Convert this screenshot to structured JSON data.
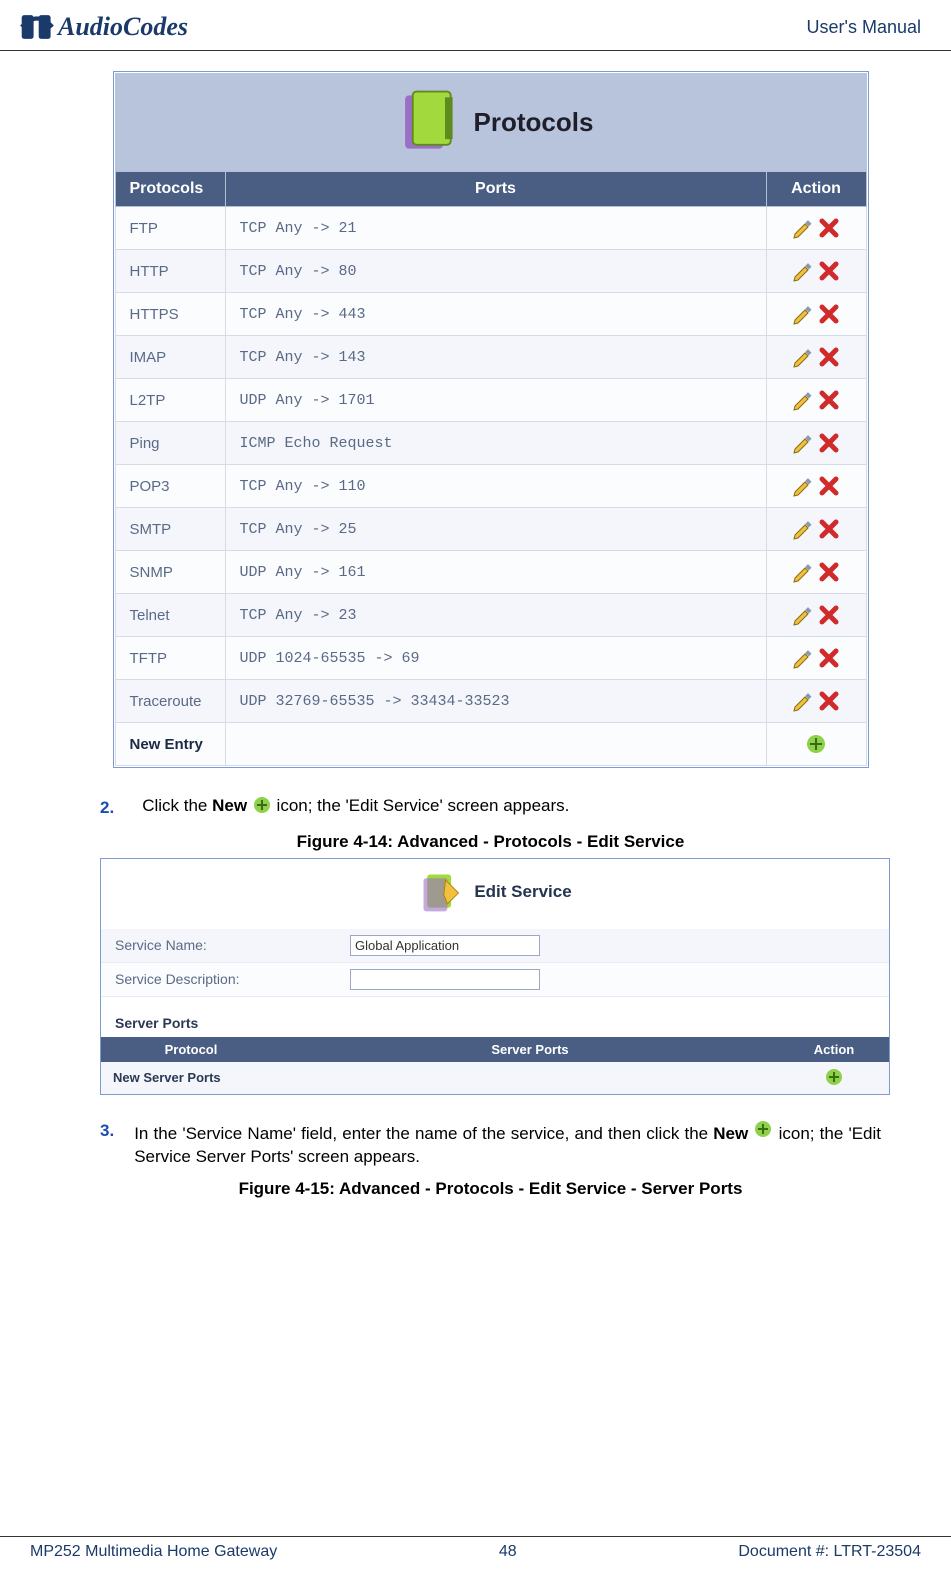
{
  "header": {
    "brand_text": "AudioCodes",
    "right_text": "User's Manual"
  },
  "figure1": {
    "title": "Protocols",
    "columns": [
      "Protocols",
      "Ports",
      "Action"
    ],
    "rows": [
      {
        "name": "FTP",
        "ports": "TCP  Any -> 21"
      },
      {
        "name": "HTTP",
        "ports": "TCP  Any -> 80"
      },
      {
        "name": "HTTPS",
        "ports": "TCP  Any -> 443"
      },
      {
        "name": "IMAP",
        "ports": "TCP  Any -> 143"
      },
      {
        "name": "L2TP",
        "ports": "UDP  Any -> 1701"
      },
      {
        "name": "Ping",
        "ports": "ICMP  Echo Request"
      },
      {
        "name": "POP3",
        "ports": "TCP  Any -> 110"
      },
      {
        "name": "SMTP",
        "ports": "TCP  Any -> 25"
      },
      {
        "name": "SNMP",
        "ports": "UDP  Any -> 161"
      },
      {
        "name": "Telnet",
        "ports": "TCP  Any -> 23"
      },
      {
        "name": "TFTP",
        "ports": "UDP  1024-65535 -> 69"
      },
      {
        "name": "Traceroute",
        "ports": "UDP  32769-65535 -> 33434-33523"
      }
    ],
    "new_entry_label": "New Entry"
  },
  "step2": {
    "number": "2.",
    "pre": "Click the ",
    "bold": "New",
    "post": " icon; the 'Edit Service' screen appears."
  },
  "caption14": "Figure 4-14: Advanced - Protocols - Edit Service",
  "figure2": {
    "title": "Edit Service",
    "form": {
      "name_label": "Service Name:",
      "name_value": "Global Application",
      "desc_label": "Service Description:",
      "desc_value": ""
    },
    "section_header": "Server Ports",
    "columns": [
      "Protocol",
      "Server Ports",
      "Action"
    ],
    "new_row_label": "New Server Ports"
  },
  "step3": {
    "number": "3.",
    "pre": "In the 'Service Name' field, enter the name of the service, and then click the ",
    "bold": "New",
    "post": "icon; the 'Edit Service Server Ports' screen appears."
  },
  "caption15": "Figure 4-15: Advanced - Protocols - Edit Service - Server Ports",
  "footer": {
    "left": "MP252 Multimedia Home Gateway",
    "center": "48",
    "right": "Document #: LTRT-23504"
  }
}
